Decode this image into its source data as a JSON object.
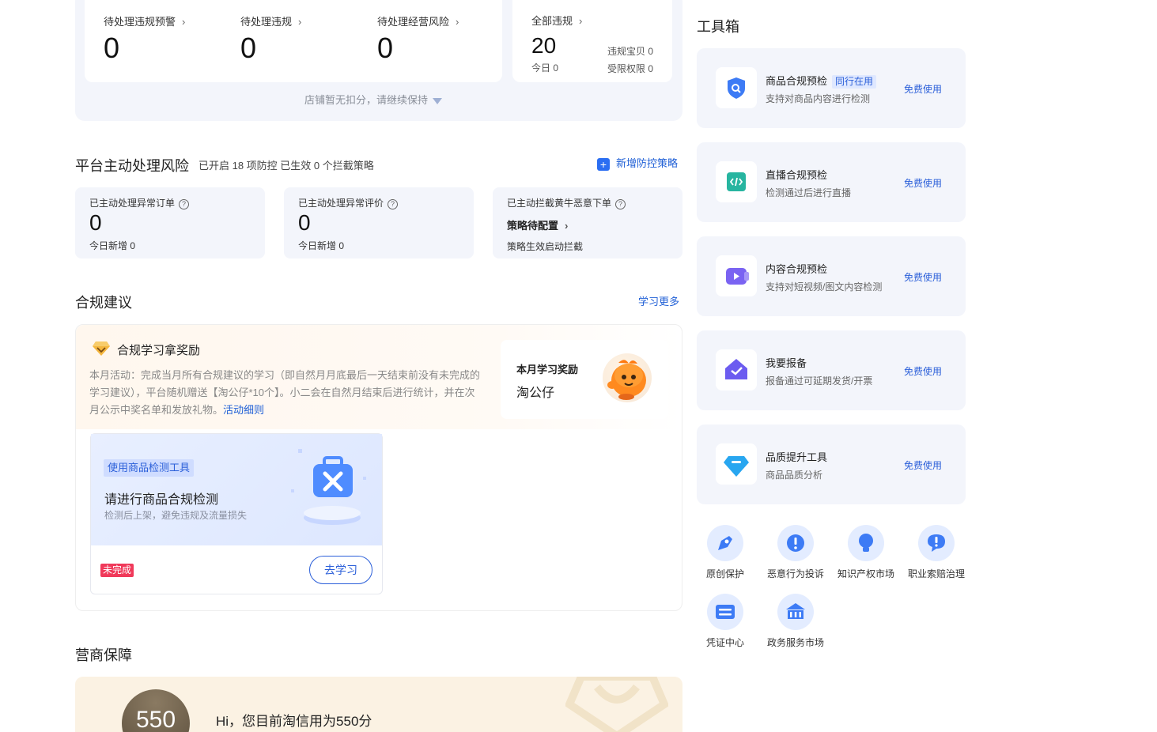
{
  "top_metrics": {
    "items": [
      {
        "label": "待处理违规预警",
        "value": "0"
      },
      {
        "label": "待处理违规",
        "value": "0"
      },
      {
        "label": "待处理经营风险",
        "value": "0"
      }
    ],
    "all": {
      "label": "全部违规",
      "value": "20",
      "today": "今日 0",
      "product": "违规宝贝 0",
      "limited": "受限权限 0"
    },
    "hint": "店铺暂无扣分，请继续保持"
  },
  "platform_risk": {
    "title": "平台主动处理风险",
    "subtitle": "已开启 18 项防控 已生效 0 个拦截策略",
    "add_label": "新增防控策略",
    "cards": [
      {
        "label": "已主动处理异常订单",
        "value": "0",
        "foot": "今日新增 0"
      },
      {
        "label": "已主动处理异常评价",
        "value": "0",
        "foot": "今日新增 0"
      },
      {
        "label": "已主动拦截黄牛恶意下单",
        "value": "策略待配置",
        "foot": "策略生效启动拦截"
      }
    ]
  },
  "advice": {
    "title": "合规建议",
    "more": "学习更多",
    "reward_title": "合规学习拿奖励",
    "reward_desc": "本月活动：完成当月所有合规建议的学习（即自然月月底最后一天结束前没有未完成的学习建议），平台随机赠送【淘公仔*10个】。小二会在自然月结束后进行统计，并在次月公示中奖名单和发放礼物。",
    "rules_link": "活动细则",
    "month_reward_label": "本月学习奖励",
    "month_reward_value": "淘公仔",
    "task": {
      "tag": "使用商品检测工具",
      "title": "请进行商品合规检测",
      "sub": "检测后上架，避免违规及流量损失",
      "status": "未完成",
      "button": "去学习"
    }
  },
  "guarantee": {
    "title": "营商保障",
    "score": "550",
    "hi": "Hi，您目前淘信用为550分"
  },
  "toolbox": {
    "title": "工具箱",
    "tools": [
      {
        "name": "商品合规预检",
        "tag": "同行在用",
        "desc": "支持对商品内容进行检测",
        "action": "免费使用",
        "icon": "shield-search-icon",
        "color": "#3d7bf5"
      },
      {
        "name": "直播合规预检",
        "tag": "",
        "desc": "检测通过后进行直播",
        "action": "免费使用",
        "icon": "code-icon",
        "color": "#27b5a0"
      },
      {
        "name": "内容合规预检",
        "tag": "",
        "desc": "支持对短视频/图文内容检测",
        "action": "免费使用",
        "icon": "video-icon",
        "color": "#7a63f2"
      },
      {
        "name": "我要报备",
        "tag": "",
        "desc": "报备通过可延期发货/开票",
        "action": "免费使用",
        "icon": "report-check-icon",
        "color": "#6c5cf0"
      },
      {
        "name": "品质提升工具",
        "tag": "",
        "desc": "商品品质分析",
        "action": "免费使用",
        "icon": "diamond-icon",
        "color": "#28a6f0"
      }
    ],
    "services": [
      {
        "label": "原创保护",
        "icon": "original-protect-icon"
      },
      {
        "label": "恶意行为投诉",
        "icon": "complaint-icon"
      },
      {
        "label": "知识产权市场",
        "icon": "ip-market-icon"
      },
      {
        "label": "职业索赔治理",
        "icon": "claim-govern-icon"
      },
      {
        "label": "凭证中心",
        "icon": "voucher-icon"
      },
      {
        "label": "政务服务市场",
        "icon": "gov-service-icon"
      }
    ]
  }
}
